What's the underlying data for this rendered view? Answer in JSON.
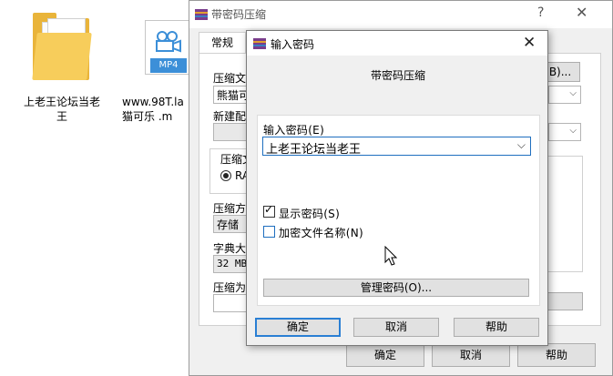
{
  "desktop": {
    "folder": {
      "label": "上老王论坛当老\n王"
    },
    "mp4": {
      "badge": "MP4",
      "label_line1": "www.98T.la",
      "label_line2": "猫可乐 .m"
    }
  },
  "background_window": {
    "title": "带密码压缩",
    "help_mark": "?",
    "close_mark": "✕",
    "tab_general": "常规",
    "labels": {
      "archive_name": "压缩文",
      "archive_value": "熊猫可",
      "new_profile": "新建配",
      "archive_format": "压缩文",
      "rar_option": "RA",
      "compression_method": "压缩方",
      "method_value": "存储",
      "dictionary_size": "字典大",
      "dict_value": "32 MB",
      "split_volumes": "压缩为"
    },
    "browse_button_fragment": "B)...",
    "buttons": {
      "ok": "确定",
      "cancel": "取消",
      "help": "帮助"
    }
  },
  "dialog": {
    "title": "输入密码",
    "close": "✕",
    "heading": "带密码压缩",
    "password_label": "输入密码(E)",
    "password_value": "上老王论坛当老王",
    "show_password": {
      "label": "显示密码(S)",
      "checked": true
    },
    "encrypt_names": {
      "label": "加密文件名称(N)",
      "checked": false
    },
    "manage_button": "管理密码(O)...",
    "buttons": {
      "ok": "确定",
      "cancel": "取消",
      "help": "帮助"
    }
  },
  "colors": {
    "accent": "#2a7fd4",
    "folder": "#f7cd5b",
    "mp4_badge": "#3c8fd8"
  }
}
